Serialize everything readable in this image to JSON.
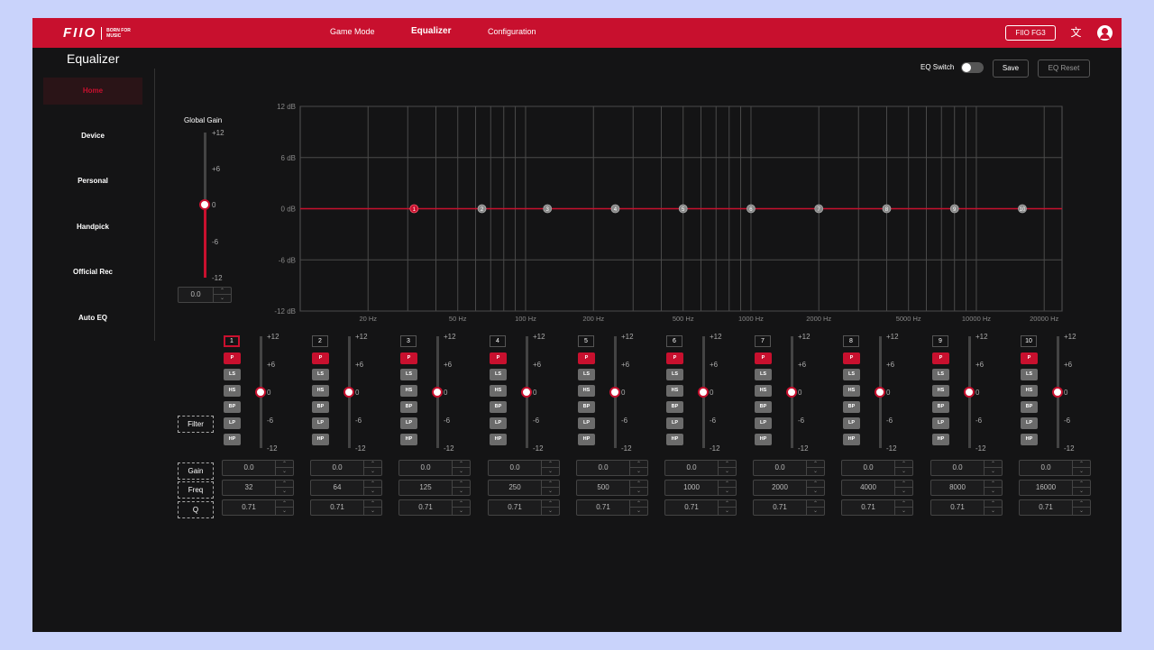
{
  "topbar": {
    "logo": "FIIO",
    "tagline": "BORN FOR MUSIC",
    "nav": [
      {
        "label": "Game Mode",
        "active": false
      },
      {
        "label": "Equalizer",
        "active": true
      },
      {
        "label": "Configuration",
        "active": false
      }
    ],
    "device_label": "FIIO FG3",
    "icons": [
      "translate-icon",
      "account-icon"
    ]
  },
  "page_title": "Equalizer",
  "sidebar": {
    "items": [
      {
        "label": "Home",
        "active": true
      },
      {
        "label": "Device",
        "active": false
      },
      {
        "label": "Personal",
        "active": false
      },
      {
        "label": "Handpick",
        "active": false
      },
      {
        "label": "Official Rec",
        "active": false
      },
      {
        "label": "Auto EQ",
        "active": false
      }
    ]
  },
  "controls": {
    "eq_switch_label": "EQ Switch",
    "eq_switch_on": false,
    "save_label": "Save",
    "reset_label": "EQ Reset"
  },
  "global_gain": {
    "label": "Global Gain",
    "ticks": [
      "+12",
      "+6",
      "0",
      "-6",
      "-12"
    ],
    "value": "0.0",
    "level_db": 0
  },
  "graph": {
    "y_ticks": [
      "12 dB",
      "6 dB",
      "0 dB",
      "-6 dB",
      "-12 dB"
    ],
    "x_ticks": [
      "20 Hz",
      "50 Hz",
      "100 Hz",
      "200 Hz",
      "500 Hz",
      "1000 Hz",
      "2000 Hz",
      "5000 Hz",
      "10000 Hz",
      "20000 Hz"
    ],
    "points": [
      "1",
      "2",
      "3",
      "4",
      "5",
      "6",
      "7",
      "8",
      "9",
      "10"
    ]
  },
  "band_slider_ticks": [
    "+12",
    "+6",
    "0",
    "-6",
    "-12"
  ],
  "filter_types": [
    "P",
    "LS",
    "HS",
    "BP",
    "LP",
    "HP"
  ],
  "row_labels": {
    "filter": "Filter",
    "gain": "Gain",
    "freq": "Freq",
    "q": "Q"
  },
  "bands": [
    {
      "num": "1",
      "filter": "P",
      "gain": "0.0",
      "freq": "32",
      "q": "0.71",
      "level_db": 0
    },
    {
      "num": "2",
      "filter": "P",
      "gain": "0.0",
      "freq": "64",
      "q": "0.71",
      "level_db": 0
    },
    {
      "num": "3",
      "filter": "P",
      "gain": "0.0",
      "freq": "125",
      "q": "0.71",
      "level_db": 0
    },
    {
      "num": "4",
      "filter": "P",
      "gain": "0.0",
      "freq": "250",
      "q": "0.71",
      "level_db": 0
    },
    {
      "num": "5",
      "filter": "P",
      "gain": "0.0",
      "freq": "500",
      "q": "0.71",
      "level_db": 0
    },
    {
      "num": "6",
      "filter": "P",
      "gain": "0.0",
      "freq": "1000",
      "q": "0.71",
      "level_db": 0
    },
    {
      "num": "7",
      "filter": "P",
      "gain": "0.0",
      "freq": "2000",
      "q": "0.71",
      "level_db": 0
    },
    {
      "num": "8",
      "filter": "P",
      "gain": "0.0",
      "freq": "4000",
      "q": "0.71",
      "level_db": 0
    },
    {
      "num": "9",
      "filter": "P",
      "gain": "0.0",
      "freq": "8000",
      "q": "0.71",
      "level_db": 0
    },
    {
      "num": "10",
      "filter": "P",
      "gain": "0.0",
      "freq": "16000",
      "q": "0.71",
      "level_db": 0
    }
  ],
  "colors": {
    "accent": "#c8102e",
    "background": "#141415",
    "page": "#c9d3fb",
    "grid": "#555555"
  }
}
